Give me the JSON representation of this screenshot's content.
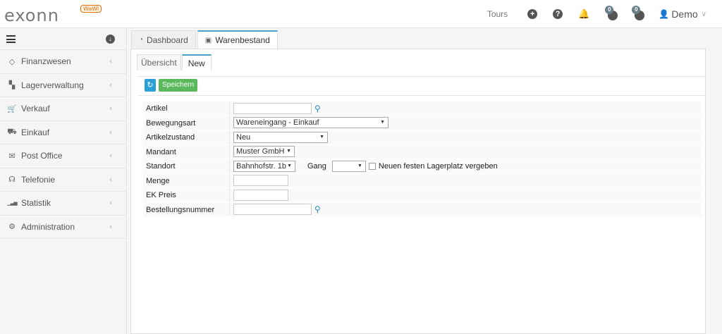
{
  "header": {
    "logo_text": "exonn",
    "logo_badge": "WaWi",
    "tours_label": "Tours",
    "plus_icon": "+",
    "help_icon": "?",
    "notif_count_1": "0",
    "notif_count_2": "0",
    "user_name": "Demo"
  },
  "sidebar": {
    "items": [
      {
        "label": "Finanzwesen",
        "icon": "◇"
      },
      {
        "label": "Lagerverwaltung",
        "icon": "▚"
      },
      {
        "label": "Verkauf",
        "icon": "🛒"
      },
      {
        "label": "Einkauf",
        "icon": "⛟"
      },
      {
        "label": "Post Office",
        "icon": "✉"
      },
      {
        "label": "Telefonie",
        "icon": "☊"
      },
      {
        "label": "Statistik",
        "icon": "▁▃▅"
      },
      {
        "label": "Administration",
        "icon": "⚙"
      }
    ]
  },
  "tabs": [
    {
      "label": "Dashboard"
    },
    {
      "label": "Warenbestand"
    }
  ],
  "subtabs": [
    {
      "label": "Übersicht"
    },
    {
      "label": "New"
    }
  ],
  "toolbar": {
    "save_label": "Speichern"
  },
  "form": {
    "artikel_label": "Artikel",
    "artikel_value": "",
    "bewegungsart_label": "Bewegungsart",
    "bewegungsart_value": "Wareneingang - Einkauf",
    "artikelzustand_label": "Artikelzustand",
    "artikelzustand_value": "Neu",
    "mandant_label": "Mandant",
    "mandant_value": "Muster GmbH",
    "standort_label": "Standort",
    "standort_value": "Bahnhofstr. 1b",
    "gang_label": "Gang",
    "gang_value": "",
    "neuer_lagerplatz_label": "Neuen festen Lagerplatz vergeben",
    "menge_label": "Menge",
    "menge_value": "",
    "ekpreis_label": "EK Preis",
    "ekpreis_value": "",
    "bestellnummer_label": "Bestellungsnummer",
    "bestellnummer_value": ""
  },
  "colors": {
    "accent": "#4aa0c8",
    "save_button": "#5cb85c",
    "refresh_button": "#2ba0d6"
  }
}
